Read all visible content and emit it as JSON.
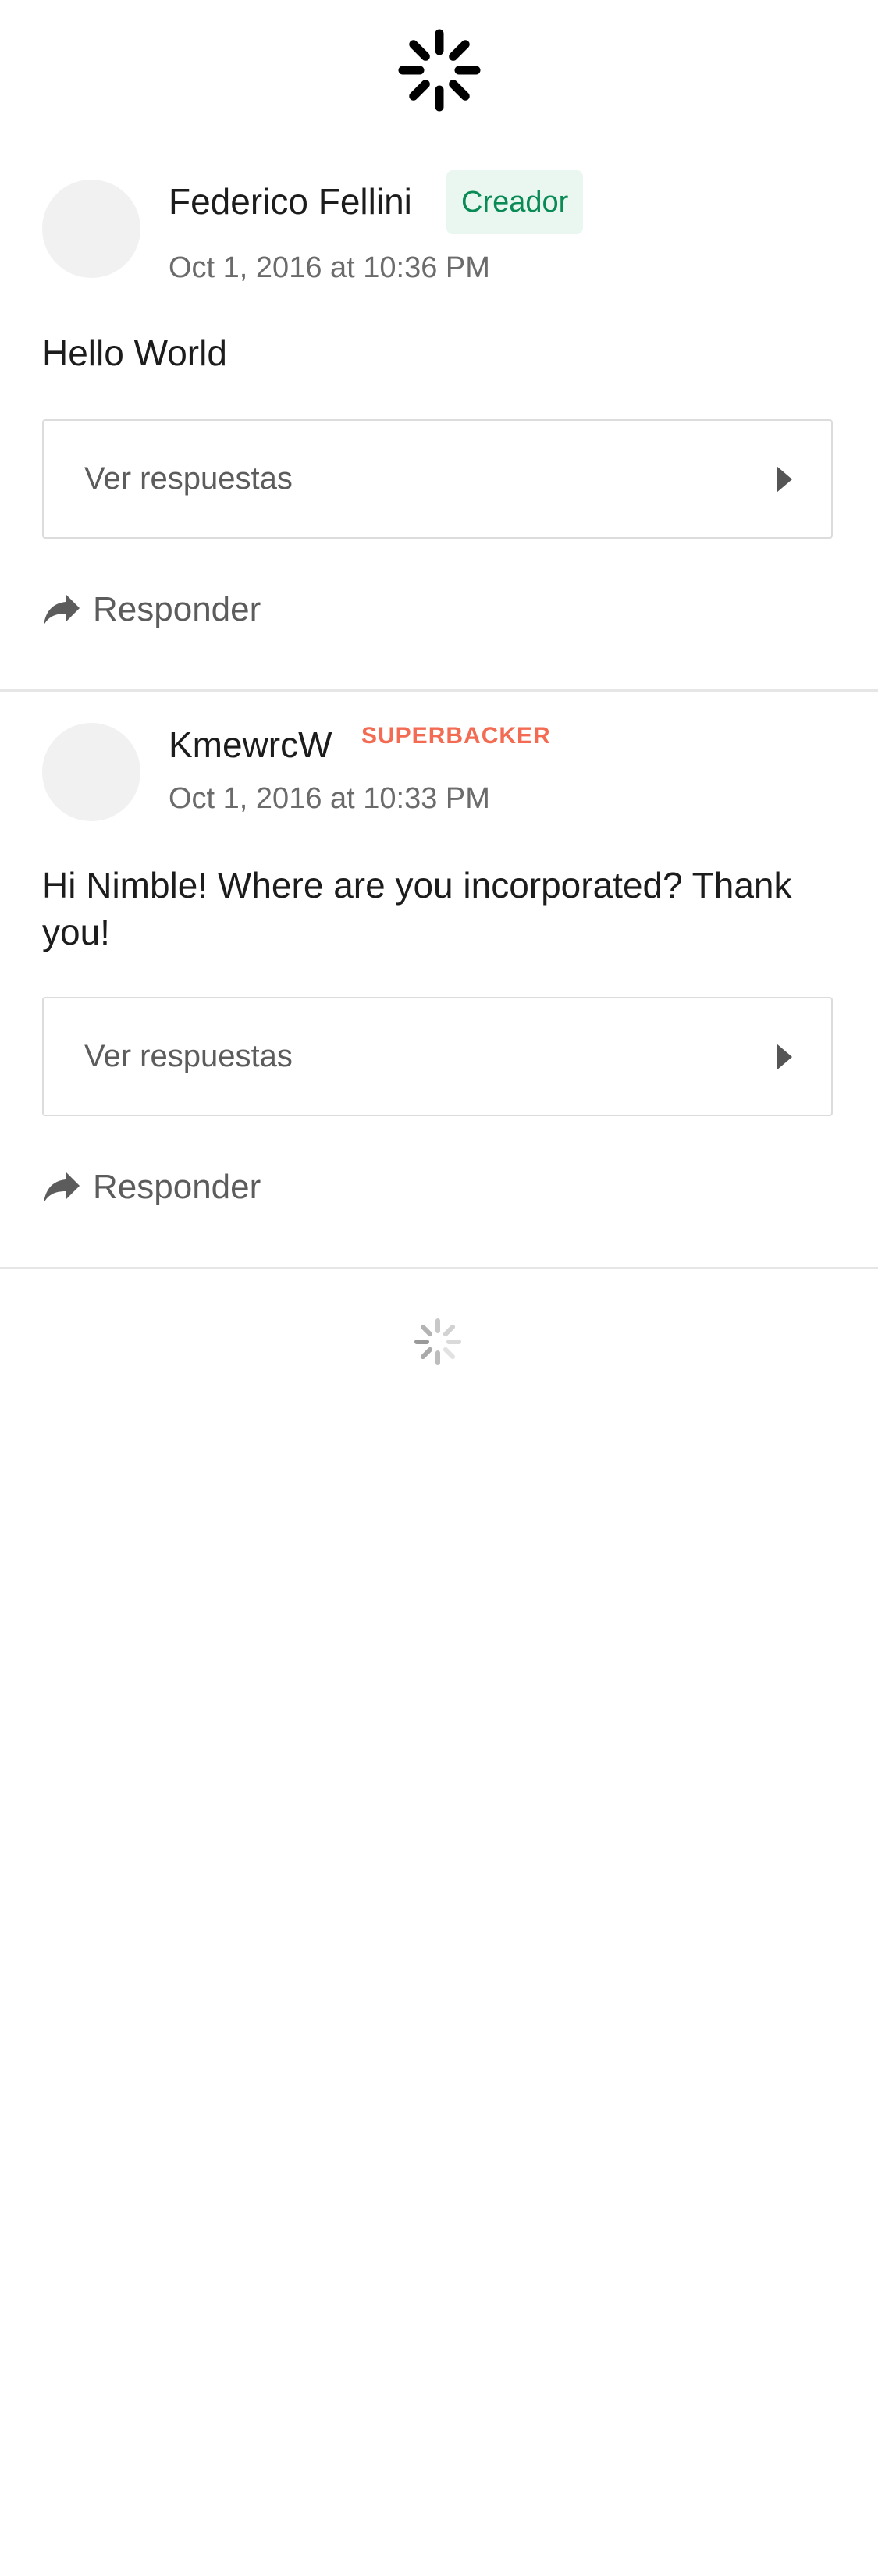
{
  "comments": [
    {
      "author": "Federico Fellini",
      "badge": "Creador",
      "timestamp": "Oct 1, 2016 at 10:36 PM",
      "body": "Hello World",
      "view_replies_label": "Ver respuestas",
      "reply_label": "Responder"
    },
    {
      "author": "KmewrcW",
      "badge": "SUPERBACKER",
      "timestamp": "Oct 1, 2016 at 10:33 PM",
      "body": "Hi Nimble! Where are you incorporated? Thank you!",
      "view_replies_label": "Ver respuestas",
      "reply_label": "Responder"
    }
  ],
  "icons": {
    "top": "loading-spinner-icon",
    "bottom": "loading-spinner-icon",
    "reply": "share-arrow-icon",
    "replies": "caret-right-icon"
  },
  "colors": {
    "creator_badge_text": "#0a8a55",
    "creator_badge_bg": "#eaf7f1",
    "superbacker": "#f26b52",
    "muted_text": "#6b6b6b",
    "divider": "#e6e6e6"
  }
}
